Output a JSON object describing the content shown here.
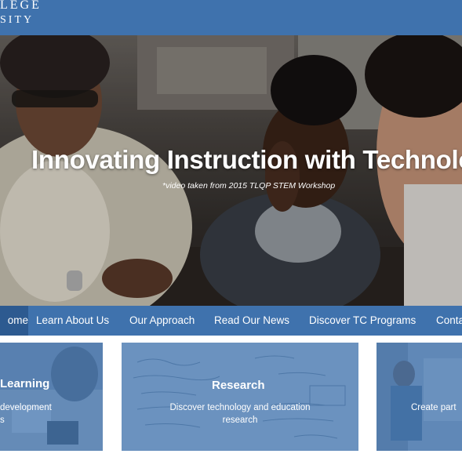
{
  "header": {
    "logo_line1": "LEGE",
    "logo_line2": "SITY"
  },
  "hero": {
    "title": "Innovating Instruction with Technology",
    "caption": "*video taken from 2015 TLQP STEM Workshop"
  },
  "nav": {
    "items": [
      {
        "label": "ome",
        "active": true
      },
      {
        "label": "Learn About Us"
      },
      {
        "label": "Our Approach"
      },
      {
        "label": "Read Our News"
      },
      {
        "label": "Discover TC Programs"
      },
      {
        "label": "Conta"
      }
    ]
  },
  "cards": [
    {
      "title": "Learning",
      "desc_line1": "development",
      "desc_line2": "s"
    },
    {
      "title": "Research",
      "desc_line1": "Discover technology and education",
      "desc_line2": "research"
    },
    {
      "title": "",
      "desc_line1": "Create part",
      "desc_line2": ""
    }
  ],
  "colors": {
    "brand_blue": "#3f72ad",
    "nav_active": "#2d5a90"
  }
}
